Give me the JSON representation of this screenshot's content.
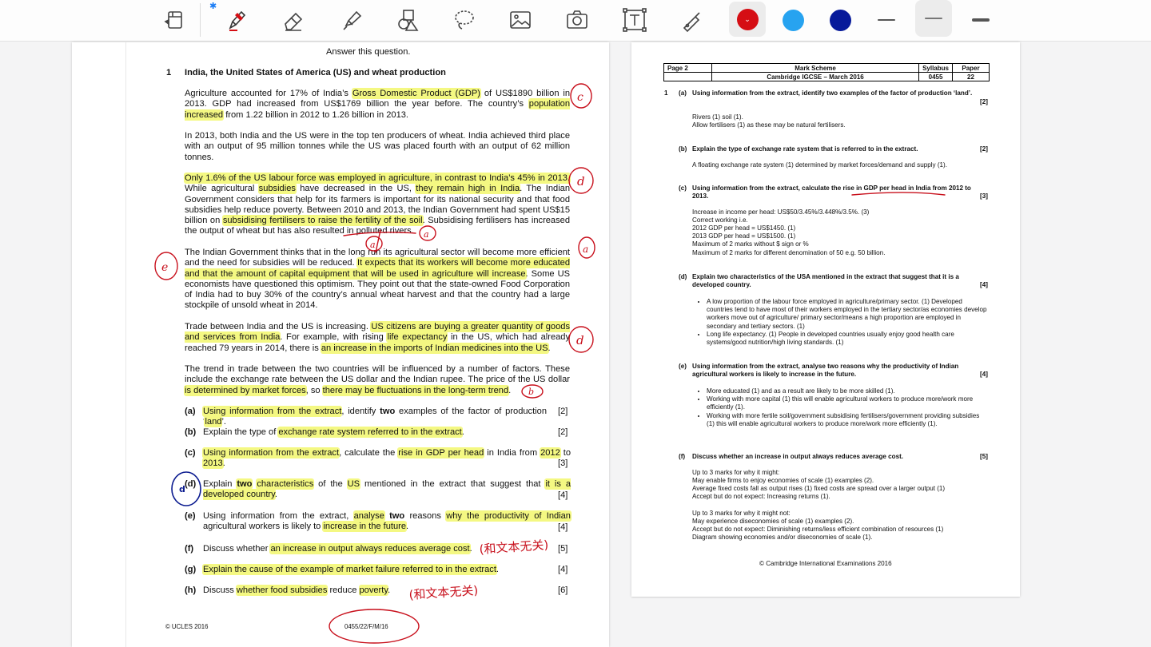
{
  "toolbar": {
    "tools": [
      "layout-icon",
      "pen-icon",
      "eraser-icon",
      "highlighter-icon",
      "shapes-icon",
      "lasso-icon",
      "image-icon",
      "camera-icon",
      "text-box-icon",
      "laser-pointer-icon"
    ],
    "colors": [
      {
        "name": "red",
        "hex": "#d50e14"
      },
      {
        "name": "light-blue",
        "hex": "#27a3f0"
      },
      {
        "name": "dark-blue",
        "hex": "#071a9a"
      }
    ],
    "stroke_widths": [
      "thin",
      "medium",
      "thick"
    ],
    "bluetooth_glyph": "✱"
  },
  "exam": {
    "instruction": "Answer this question.",
    "q_number": "1",
    "q_title": "India, the United States of America (US) and wheat production",
    "para1": [
      "Agriculture accounted for 17% of India’s ",
      "Gross Domestic Product (GDP)",
      " of US$1890 billion in 2013. GDP had increased from US$1769 billion the year before. The country’s ",
      "population increased",
      " from 1.22 billion in 2012 to 1.26 billion in 2013."
    ],
    "para2": "In 2013, both India and the US were in the top ten producers of wheat. India achieved third place with an output of 95 million tonnes while the US was placed fourth with an output of 62 million tonnes.",
    "para3": [
      "Only 1.6% of the US labour force was employed in agriculture, in contrast to India’s 45% in 2013.",
      " While agricultural ",
      "subsidies",
      " have decreased in the US, ",
      "they remain high in India",
      ". The Indian Government considers that help for its farmers is important for its national security and that food subsidies help reduce poverty. Between 2010 and 2013, the Indian Government had spent US$15 billion on ",
      "subsidising fertilisers to raise the fertility of the soil",
      ". Subsidising fertilisers has increased the output of wheat but has also resulted in polluted rivers."
    ],
    "para4": [
      "The Indian Government thinks that in the long run its agricultural sector will become more efficient and the need for subsidies will be reduced. ",
      "It expects that its workers will become more educated and that the amount of capital equipment that will be used in agriculture will increase",
      ". Some US economists have questioned this optimism. They point out that the state-owned Food Corporation of India had to buy 30% of the country’s annual wheat harvest and that the country had a large stockpile of unsold wheat in 2014."
    ],
    "para5": [
      "Trade between India and the US is increasing. ",
      "US citizens are buying a greater quantity of goods and services from India",
      ". For example, with rising ",
      "life expectancy",
      " in the US, which had already reached 79 years in 2014, there is ",
      "an increase in the imports of Indian medicines into the US",
      "."
    ],
    "para6": [
      "The trend in trade between the two countries will be influenced by a number of factors. These include the exchange rate between the US dollar and the Indian rupee. The price of the US dollar ",
      "is determined by market forces",
      ", so ",
      "there may be fluctuations in the long-term trend",
      "."
    ],
    "subquestions": [
      {
        "label": "(a)",
        "parts": [
          "",
          "Using information from the extract",
          ", identify ",
          "two",
          " examples of the factor of production ‘",
          "land",
          "’."
        ],
        "marks": "[2]"
      },
      {
        "label": "(b)",
        "parts": [
          "Explain the type of ",
          "exchange rate system referred to in the extract",
          "."
        ],
        "marks": "[2]"
      },
      {
        "label": "(c)",
        "parts": [
          "",
          "Using information from the extract",
          ", calculate the ",
          "rise in GDP per head",
          " in India from ",
          "2012",
          " to ",
          "2013",
          "."
        ],
        "marks": "[3]"
      },
      {
        "label": "(d)",
        "parts": [
          "Explain ",
          "two",
          " ",
          "characteristics",
          " of the ",
          "US",
          " mentioned in the extract that suggest that ",
          "it is a developed country",
          "."
        ],
        "marks": "[4]"
      },
      {
        "label": "(e)",
        "parts": [
          "Using information from the extract, ",
          "analyse",
          " ",
          "two",
          " reasons ",
          "why the productivity of Indian",
          " agricultural workers is likely to ",
          "increase in the future",
          "."
        ],
        "marks": "[4]"
      },
      {
        "label": "(f)",
        "parts": [
          "Discuss whether ",
          "an increase in output always reduces average cost",
          "."
        ],
        "marks": "[5]"
      },
      {
        "label": "(g)",
        "parts": [
          "",
          "Explain the cause of the example of market failure referred to in the extract",
          "."
        ],
        "marks": "[4]"
      },
      {
        "label": "(h)",
        "parts": [
          "Discuss ",
          "whether food subsidies",
          " reduce ",
          "poverty",
          "."
        ],
        "marks": "[6]"
      }
    ],
    "footer_left": "© UCLES 2016",
    "footer_code": "0455/22/F/M/16"
  },
  "markscheme": {
    "header": {
      "page": "Page 2",
      "title": "Mark Scheme",
      "syllabus_label": "Syllabus",
      "paper_label": "Paper",
      "subtitle": "Cambridge IGCSE – March 2016",
      "syllabus": "0455",
      "paper": "22"
    },
    "q1_number": "1",
    "sections": [
      {
        "label": "(a)",
        "question": "Using information from the extract, identify two examples of the factor of production ‘land’.",
        "marks": "[2]",
        "lines": [
          "Rivers (1) soil (1).",
          "Allow fertilisers (1) as these may be natural fertilisers."
        ]
      },
      {
        "label": "(b)",
        "question": "Explain the type of exchange rate system that is referred to in the extract.",
        "marks": "[2]",
        "lines": [
          "A floating exchange rate system (1) determined by market forces/demand and supply (1)."
        ]
      },
      {
        "label": "(c)",
        "question": "Using information from the extract, calculate the rise in GDP per head in India from 2012 to 2013.",
        "marks": "[3]",
        "lines": [
          "Increase in income per head: US$50/3.45%/3.448%/3.5%. (3)",
          "Correct working i.e.",
          "2012 GDP per head = US$1450. (1)",
          "2013 GDP per head = US$1500. (1)",
          "Maximum of 2 marks without $ sign or %",
          "Maximum of 2 marks for different denomination of 50 e.g. 50 billion."
        ]
      },
      {
        "label": "(d)",
        "question": "Explain two characteristics of the USA mentioned in the extract that suggest that it is a developed country.",
        "marks": "[4]",
        "bullets": [
          "A low proportion of the labour force employed in agriculture/primary sector. (1) Developed countries tend to have most of their workers employed in the tertiary sector/as economies develop workers move out of agriculture/ primary sector/means a high proportion are employed in secondary and tertiary sectors. (1)",
          "Long life expectancy. (1) People in developed countries usually enjoy good health care systems/good nutrition/high living standards. (1)"
        ]
      },
      {
        "label": "(e)",
        "question": "Using information from the extract, analyse two reasons why the productivity of Indian agricultural workers is likely to increase in the future.",
        "marks": "[4]",
        "bullets": [
          "More educated (1) and as a result are likely to be more skilled (1).",
          "Working with more capital (1) this will enable agricultural workers to produce more/work more efficiently (1).",
          "Working with more fertile soil/government subsidising fertilisers/government providing subsidies (1) this will enable agricultural workers to produce more/work more efficiently (1)."
        ]
      },
      {
        "label": "(f)",
        "question": "Discuss whether an increase in output always reduces average cost.",
        "marks": "[5]",
        "lines": [
          "Up to 3 marks for why it might:",
          "May enable firms to enjoy economies of scale (1) examples (2).",
          "Average fixed costs fall as output rises (1) fixed costs are spread over a larger output (1)",
          "Accept but do not expect: Increasing returns (1).",
          "",
          "Up to 3 marks for why it might not:",
          "May experience diseconomies of scale (1) examples (2).",
          "Accept but do not expect: Diminishing returns/less efficient combination of resources (1)",
          "Diagram showing economies and/or diseconomies of scale (1)."
        ]
      }
    ],
    "footer": "© Cambridge International Examinations 2016"
  },
  "annotations": {
    "letters": [
      "c",
      "d",
      "a",
      "a",
      "a",
      "e",
      "d",
      "b",
      "d"
    ],
    "notes": [
      "(和文本无关)",
      "(和文本无关)"
    ]
  }
}
